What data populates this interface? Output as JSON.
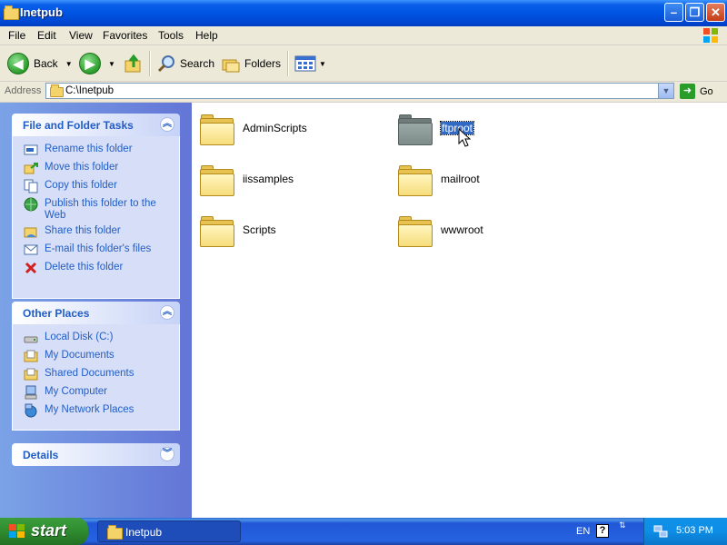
{
  "window": {
    "title": "Inetpub"
  },
  "menu": [
    "File",
    "Edit",
    "View",
    "Favorites",
    "Tools",
    "Help"
  ],
  "toolbar": {
    "back": "Back",
    "search": "Search",
    "folders": "Folders"
  },
  "address": {
    "label": "Address",
    "path": "C:\\Inetpub",
    "go": "Go"
  },
  "tasks_panel": {
    "title": "File and Folder Tasks",
    "items": [
      "Rename this folder",
      "Move this folder",
      "Copy this folder",
      "Publish this folder to the Web",
      "Share this folder",
      "E-mail this folder's files",
      "Delete this folder"
    ]
  },
  "places_panel": {
    "title": "Other Places",
    "items": [
      "Local Disk (C:)",
      "My Documents",
      "Shared Documents",
      "My Computer",
      "My Network Places"
    ]
  },
  "details_panel": {
    "title": "Details"
  },
  "folders": [
    {
      "name": "AdminScripts",
      "selected": false
    },
    {
      "name": "ftproot",
      "selected": true
    },
    {
      "name": "iissamples",
      "selected": false
    },
    {
      "name": "mailroot",
      "selected": false
    },
    {
      "name": "Scripts",
      "selected": false
    },
    {
      "name": "wwwroot",
      "selected": false
    }
  ],
  "taskbar": {
    "start": "start",
    "task": "Inetpub",
    "lang": "EN",
    "clock": "5:03 PM"
  },
  "colors": {
    "title_blue": "#0054e3",
    "link_blue": "#215dc6",
    "selection": "#316ac5",
    "start_green": "#2f8b2f"
  }
}
